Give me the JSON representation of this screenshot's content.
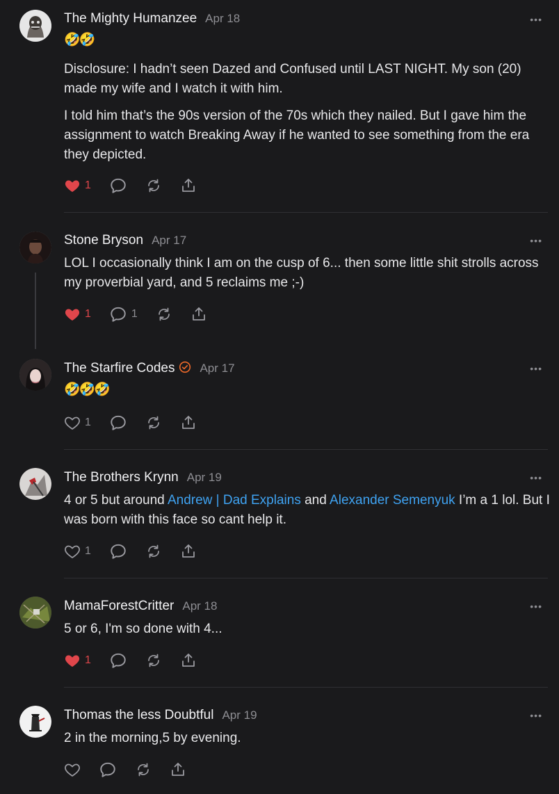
{
  "comments": [
    {
      "name": "The Mighty Humanzee",
      "date": "Apr 18",
      "emoji": "🤣🤣",
      "paragraphs": [
        "Disclosure: I hadn’t seen Dazed and Confused until LAST NIGHT. My son (20) made my wife and I watch it with him.",
        "I told him that’s the 90s version of the 70s which they nailed. But I gave him the assignment to watch Breaking Away if he wanted to see something from the era they depicted."
      ],
      "likes": "1",
      "liked": true
    },
    {
      "name": "Stone Bryson",
      "date": "Apr 17",
      "text": "LOL I occasionally think I am on the cusp of 6... then some little shit strolls across my proverbial yard, and 5 reclaims me ;-)",
      "likes": "1",
      "liked": true,
      "replies": "1"
    },
    {
      "name": "The Starfire Codes",
      "date": "Apr 17",
      "emoji": "🤣🤣🤣",
      "likes": "1",
      "liked": false
    },
    {
      "name": "The Brothers Krynn",
      "date": "Apr 19",
      "text_a": "4 or 5 but around ",
      "link1": "Andrew | Dad Explains",
      "text_b": " and ",
      "link2": "Alexander Semenyuk",
      "text_c": " I’m a 1 lol. But I was born with this face so cant help it.",
      "likes": "1",
      "liked": false
    },
    {
      "name": "MamaForestCritter",
      "date": "Apr 18",
      "text": "5 or 6, I'm so done with 4...",
      "likes": "1",
      "liked": true
    },
    {
      "name": "Thomas the less Doubtful",
      "date": "Apr 19",
      "text": "2 in the morning,5 by evening.",
      "liked": false
    }
  ],
  "more_label": "•••",
  "icons": [
    "heart-icon",
    "reply-icon",
    "restack-icon",
    "share-icon",
    "verified-icon"
  ],
  "colors": {
    "background": "#1a1a1c",
    "link": "#3fa3f2",
    "heart": "#e0464b",
    "verified": "#f06a2a"
  }
}
